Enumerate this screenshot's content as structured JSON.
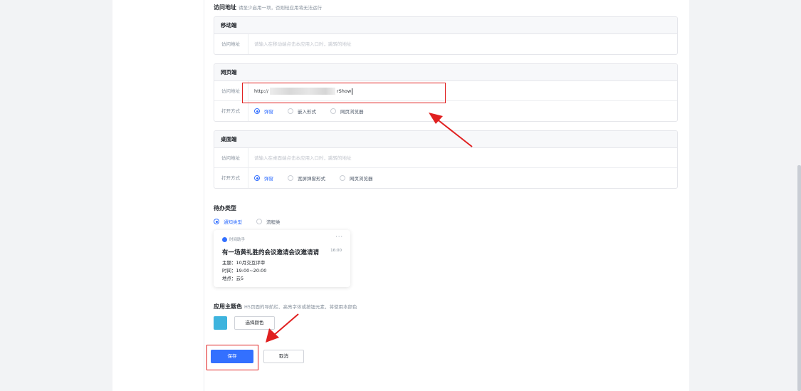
{
  "access_url": {
    "title": "访问地址",
    "hint": "请至少启用一项，否则轻应用将无法运行"
  },
  "mobile": {
    "title": "移动端",
    "url_label": "访问地址",
    "url_placeholder": "请输入在移动端点击本应用入口时，跳转的地址"
  },
  "web": {
    "title": "网页端",
    "url_label": "访问地址",
    "url_prefix": "http://",
    "url_suffix": "rShow",
    "open_label": "打开方式",
    "open_options": [
      "弹窗",
      "嵌入形式",
      "网页浏览器"
    ],
    "selected": "弹窗"
  },
  "desktop": {
    "title": "桌面端",
    "url_label": "访问地址",
    "url_placeholder": "请输入在桌面端点击本应用入口时，跳转的地址",
    "open_label": "打开方式",
    "open_options": [
      "弹窗",
      "宽屏弹窗形式",
      "网页浏览器"
    ],
    "selected": "弹窗"
  },
  "todo": {
    "title": "待办类型",
    "options": [
      "通知类型",
      "流程类"
    ],
    "selected": "通知类型"
  },
  "preview": {
    "app_name": "时间助手",
    "more": "···",
    "title": "有一场黄礼胜的会议邀请会议邀请请",
    "time": "16:00",
    "lines": [
      "主题：10月交互评审",
      "时间：19:00~20:00",
      "地点：云5"
    ]
  },
  "theme": {
    "title": "应用主题色",
    "hint": "H5页面的导航栏、高亮字体或按钮元素，将使用本颜色",
    "color": "#3eb4de",
    "pick_label": "选择颜色"
  },
  "actions": {
    "save": "保存",
    "cancel": "取消"
  },
  "colors": {
    "primary": "#3370ff",
    "annotation": "#e02020"
  }
}
